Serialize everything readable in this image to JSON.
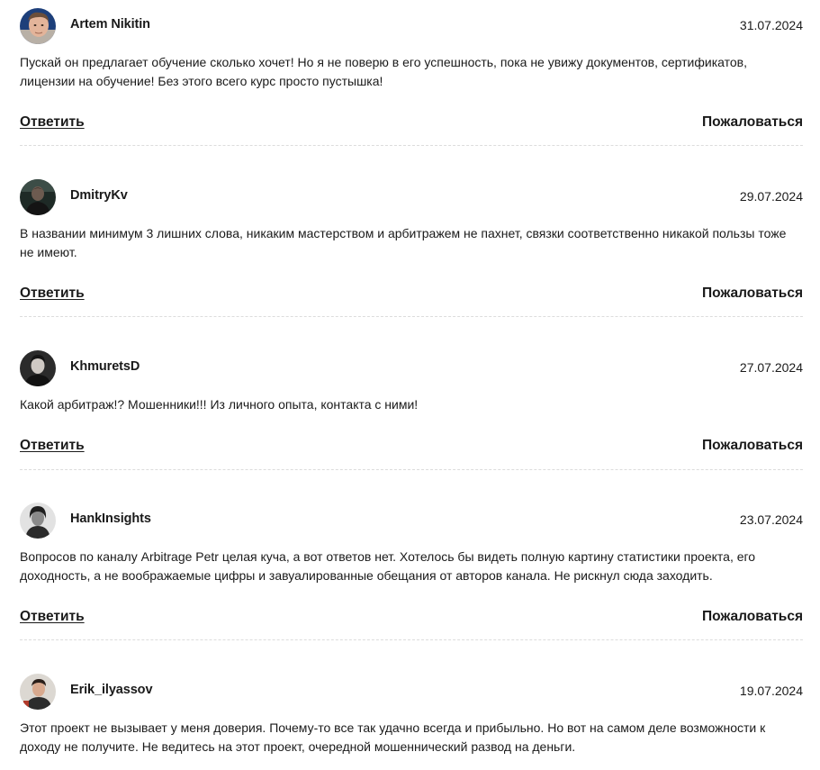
{
  "comments": [
    {
      "author": "Artem Nikitin",
      "date": "31.07.2024",
      "text": "Пускай он предлагает обучение сколько хочет! Но я не поверю в его успешность, пока не увижу документов, сертификатов, лицензии на обучение! Без этого всего курс просто пустышка!",
      "reply": "Ответить",
      "report": "Пожаловаться"
    },
    {
      "author": "DmitryKv",
      "date": "29.07.2024",
      "text": "В названии минимум 3 лишних слова, никаким мастерством и арбитражем не пахнет, связки соответственно никакой пользы тоже не имеют.",
      "reply": "Ответить",
      "report": "Пожаловаться"
    },
    {
      "author": "KhmuretsD",
      "date": "27.07.2024",
      "text": "Какой арбитраж!? Мошенники!!! Из личного опыта, контакта с ними!",
      "reply": "Ответить",
      "report": "Пожаловаться"
    },
    {
      "author": "HankInsights",
      "date": "23.07.2024",
      "text": "Вопросов по каналу Arbitrage Petr целая куча, а вот ответов нет. Хотелось бы видеть полную картину статистики проекта, его доходность, а не воображаемые цифры и завуалированные обещания от авторов канала. Не рискнул сюда заходить.",
      "reply": "Ответить",
      "report": "Пожаловаться"
    },
    {
      "author": "Erik_ilyassov",
      "date": "19.07.2024",
      "text": "Этот проект не вызывает у меня доверия. Почему-то все так удачно всегда и прибыльно. Но вот на самом деле возможности к доходу не получите. Не ведитесь на этот проект, очередной мошеннический развод на деньги."
    }
  ]
}
